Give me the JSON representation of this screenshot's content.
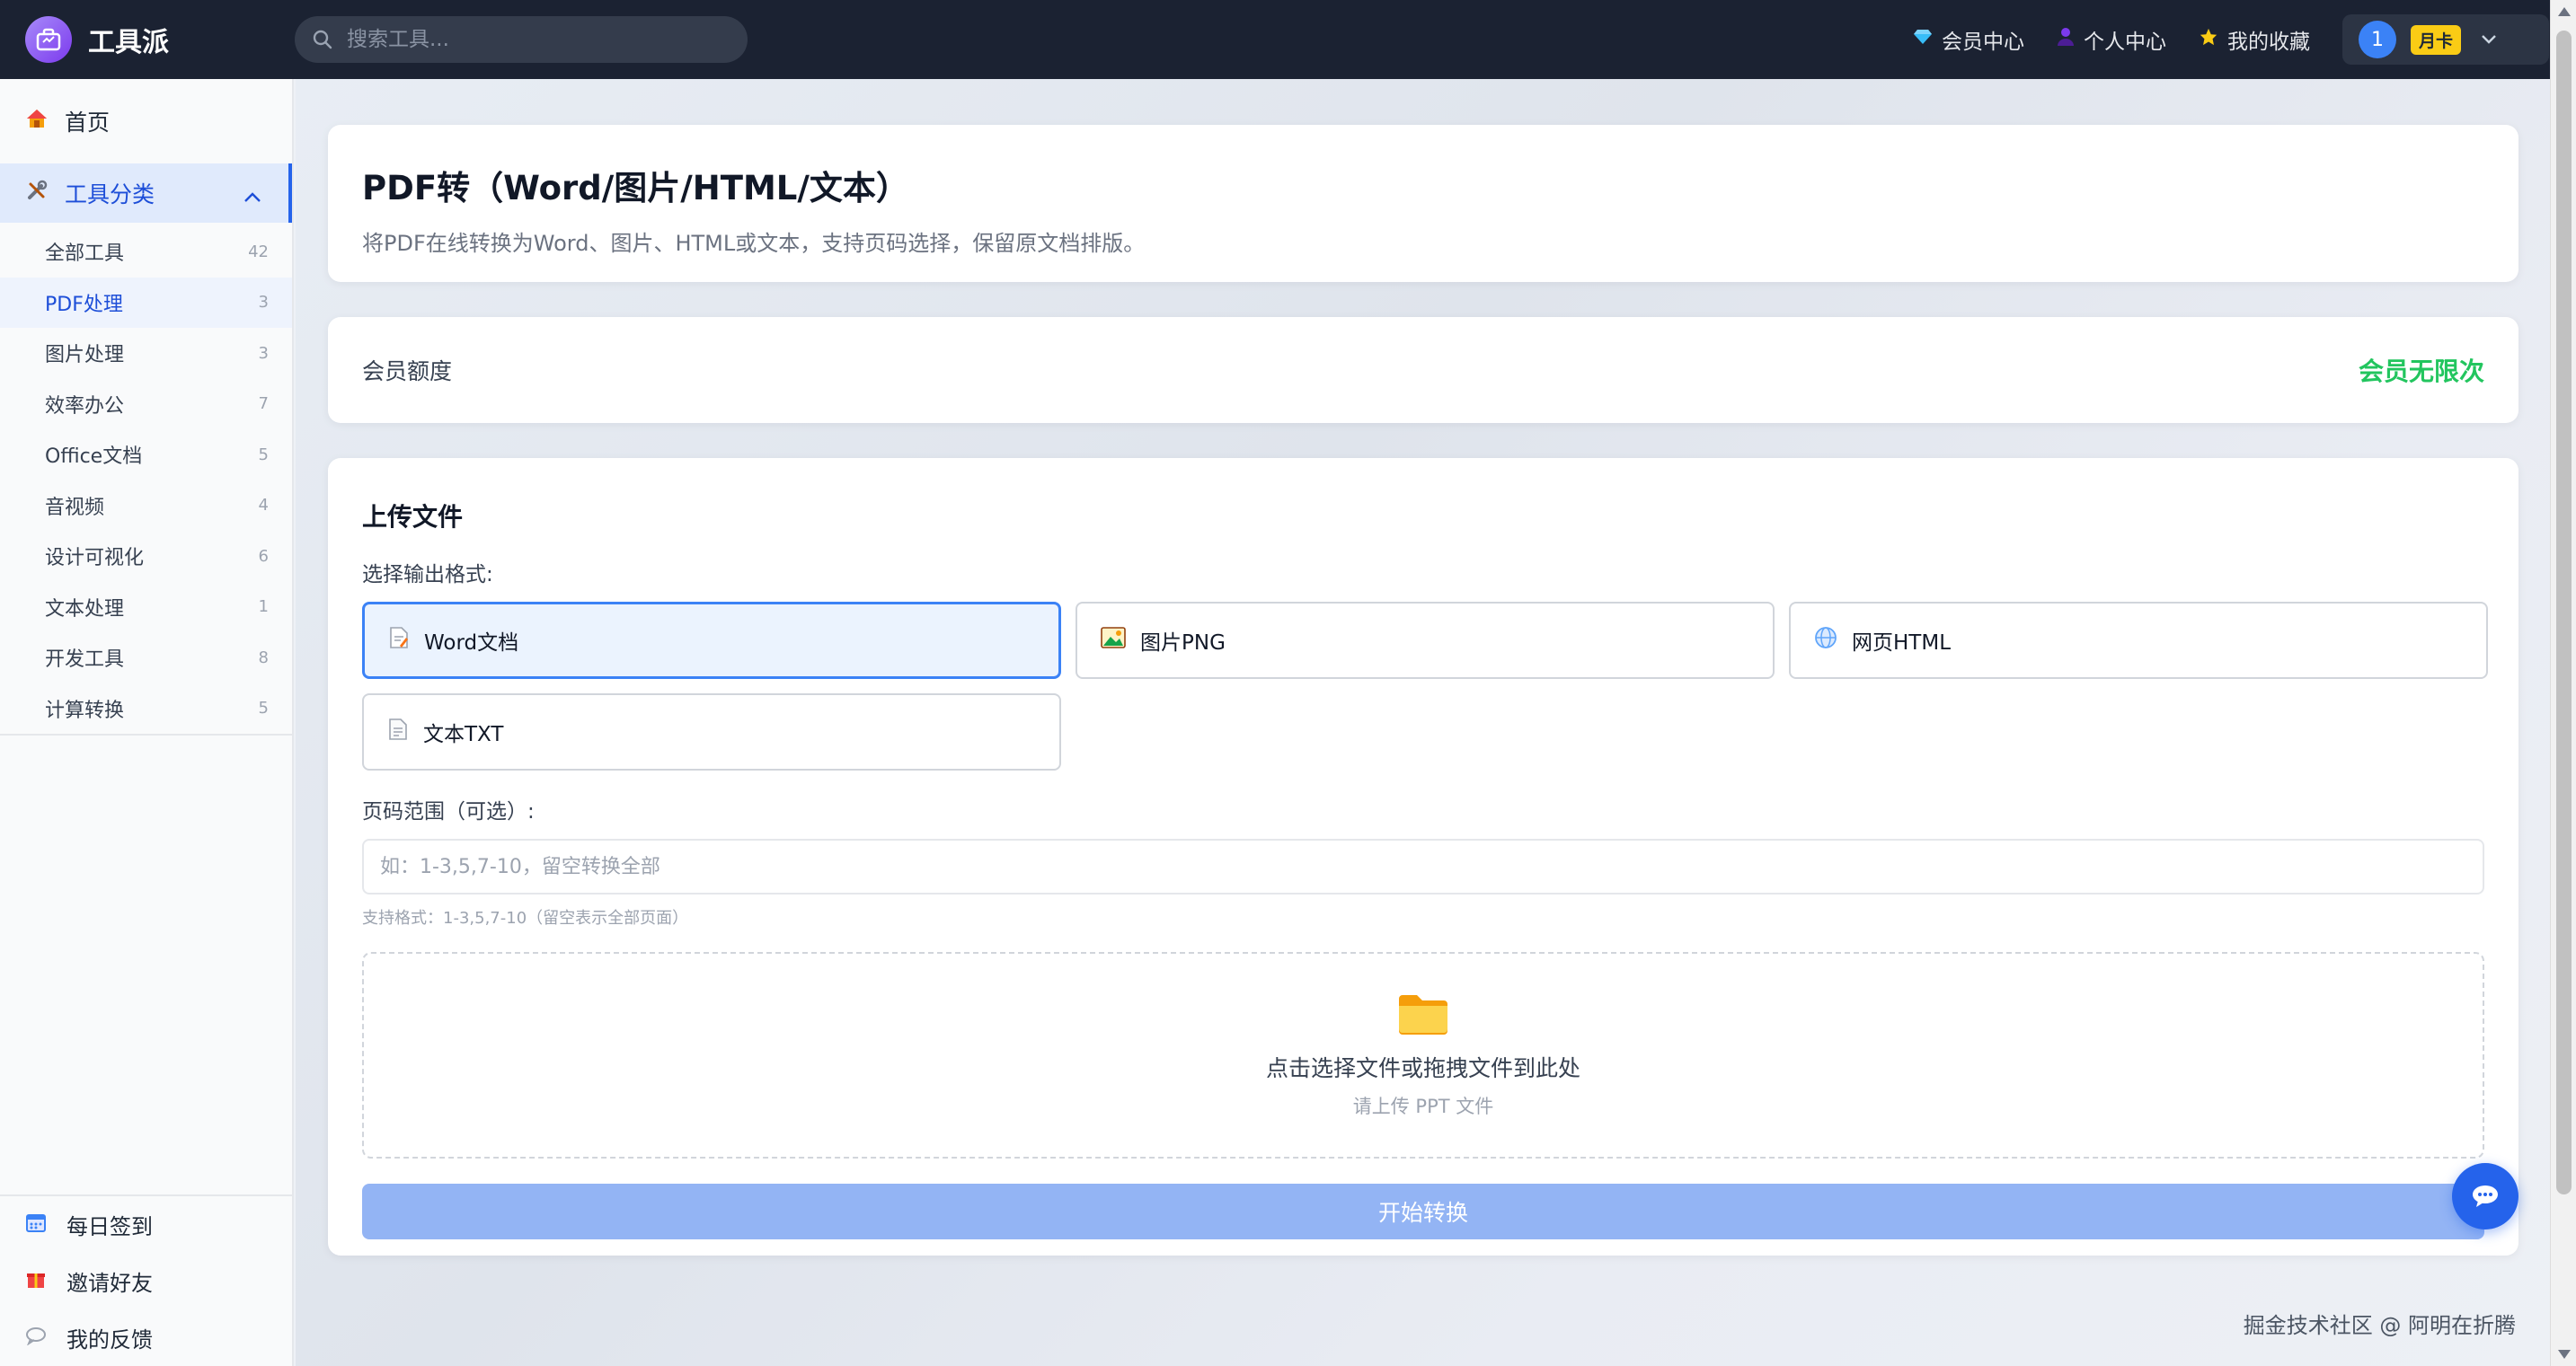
{
  "app": {
    "name": "工具派"
  },
  "search": {
    "placeholder": "搜索工具..."
  },
  "topnav": {
    "member_center": "会员中心",
    "personal_center": "个人中心",
    "favorites": "我的收藏",
    "user_avatar": "1",
    "plan_badge": "月卡"
  },
  "sidebar": {
    "home": "首页",
    "category_header": "工具分类",
    "categories": [
      {
        "label": "全部工具",
        "count": "42"
      },
      {
        "label": "PDF处理",
        "count": "3"
      },
      {
        "label": "图片处理",
        "count": "3"
      },
      {
        "label": "效率办公",
        "count": "7"
      },
      {
        "label": "Office文档",
        "count": "5"
      },
      {
        "label": "音视频",
        "count": "4"
      },
      {
        "label": "设计可视化",
        "count": "6"
      },
      {
        "label": "文本处理",
        "count": "1"
      },
      {
        "label": "开发工具",
        "count": "8"
      },
      {
        "label": "计算转换",
        "count": "5"
      }
    ],
    "bottom": {
      "checkin": "每日签到",
      "invite": "邀请好友",
      "feedback": "我的反馈"
    }
  },
  "page": {
    "title": "PDF转（Word/图片/HTML/文本）",
    "description": "将PDF在线转换为Word、图片、HTML或文本，支持页码选择，保留原文档排版。"
  },
  "quota": {
    "label": "会员额度",
    "value": "会员无限次"
  },
  "upload": {
    "section_title": "上传文件",
    "format_label": "选择输出格式:",
    "formats": [
      {
        "label": "Word文档",
        "icon": "word-doc-icon"
      },
      {
        "label": "图片PNG",
        "icon": "image-icon"
      },
      {
        "label": "网页HTML",
        "icon": "globe-icon"
      },
      {
        "label": "文本TXT",
        "icon": "text-file-icon"
      }
    ],
    "selected_format": "Word文档",
    "range_label": "页码范围（可选）:",
    "range_placeholder": "如：1-3,5,7-10，留空转换全部",
    "range_hint": "支持格式：1-3,5,7-10（留空表示全部页面）",
    "dropzone_title": "点击选择文件或拖拽文件到此处",
    "dropzone_sub": "请上传 PPT 文件",
    "submit": "开始转换"
  },
  "watermark": "掘金技术社区 @ 阿明在折腾",
  "colors": {
    "header_bg": "#1b2232",
    "accent": "#2563eb",
    "success": "#22c55e",
    "badge": "#facc15"
  }
}
